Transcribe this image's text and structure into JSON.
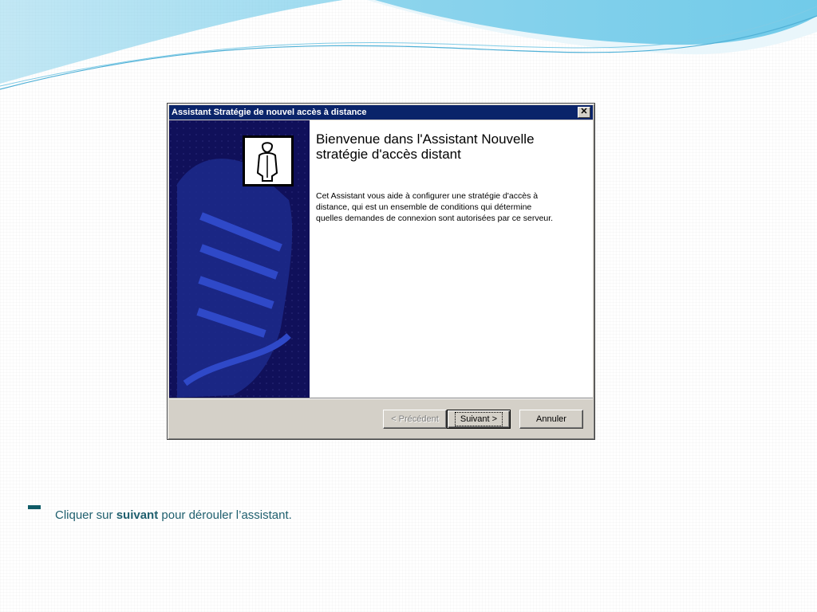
{
  "dialog": {
    "title": "Assistant Stratégie de nouvel accès à distance",
    "close_label": "✕",
    "welcome_title": "Bienvenue dans l'Assistant Nouvelle stratégie d'accès distant",
    "description": "Cet Assistant vous aide à configurer une stratégie d'accès à distance, qui est un ensemble de conditions qui détermine quelles demandes de connexion sont autorisées par ce serveur.",
    "buttons": {
      "previous": "< Précédent",
      "next": "Suivant >",
      "cancel": "Annuler"
    }
  },
  "slide": {
    "bullet_prefix": "Cliquer sur ",
    "bullet_bold": "suivant",
    "bullet_suffix": " pour dérouler l’assistant."
  },
  "colors": {
    "titlebar": "#0a246a",
    "sidebar": "#10105a",
    "accent_text": "#1f5f6e"
  }
}
